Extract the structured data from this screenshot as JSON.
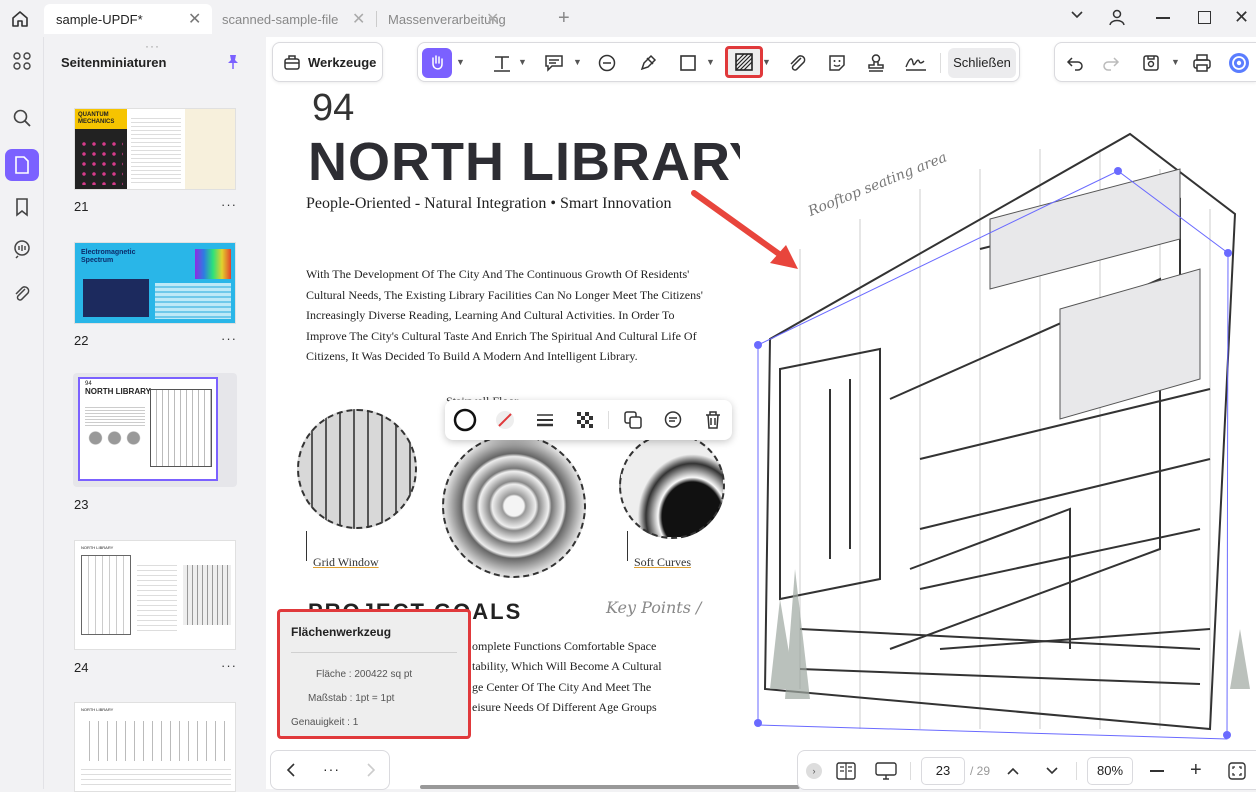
{
  "tabs": [
    {
      "label": "sample-UPDF*",
      "active": true
    },
    {
      "label": "scanned-sample-file",
      "active": false
    },
    {
      "label": "Massenverarbeitung",
      "active": false
    }
  ],
  "sidebar": {
    "title": "Seitenminiaturen",
    "thumbnails": [
      {
        "page": "21",
        "caption_lines": [
          "QUANTUM",
          "MECHANICS"
        ]
      },
      {
        "page": "22",
        "caption_lines": [
          "Electromagnetic",
          "Spectrum"
        ]
      },
      {
        "page": "23",
        "caption_lines": [
          "94",
          "NORTH LIBRARY"
        ]
      },
      {
        "page": "24",
        "caption_lines": [
          "NORTH LIBRARY"
        ]
      },
      {
        "page": "",
        "caption_lines": [
          "NORTH LIBRARY"
        ]
      }
    ],
    "more": "···"
  },
  "toolbar": {
    "tools_label": "Werkzeuge",
    "close_label": "Schließen"
  },
  "page": {
    "number": "94",
    "title": "NORTH LIBRARY",
    "subtitle": "People-Oriented - Natural Integration • Smart Innovation",
    "body": "With The Development Of The City And The Continuous Growth Of Residents' Cultural Needs, The Existing Library Facilities Can No Longer Meet The Citizens' Increasingly Diverse Reading, Learning And Cultural Activities. In Order To Improve The City's Cultural Taste And Enrich The Spiritual And Cultural Life Of Citizens, It Was Decided To Build A Modern And Intelligent Library.",
    "roof_label": "Rooftop seating area",
    "labels": [
      "Grid Window",
      "Soft Curves"
    ],
    "partial_label": "Stairwell Floor",
    "key_points": "Key Points /",
    "section_heading": "PROJECT GOALS",
    "goals_lines": [
      "omplete Functions Comfortable Space",
      "tability, Which Will Become A Cultural",
      "ge Center Of The City And Meet The",
      "eisure Needs Of Different Age Groups"
    ]
  },
  "area_tool": {
    "title": "Flächenwerkzeug",
    "area": "Fläche : 200422 sq pt",
    "scale": "Maßstab : 1pt = 1pt",
    "precision": "Genauigkeit : 1"
  },
  "bottom": {
    "more": "···",
    "current_page": "23",
    "total_pages": "/ 29",
    "zoom": "80%"
  },
  "colors": {
    "accent": "#7b61ff",
    "highlight": "#e0393b",
    "arrow": "#e8453c"
  }
}
